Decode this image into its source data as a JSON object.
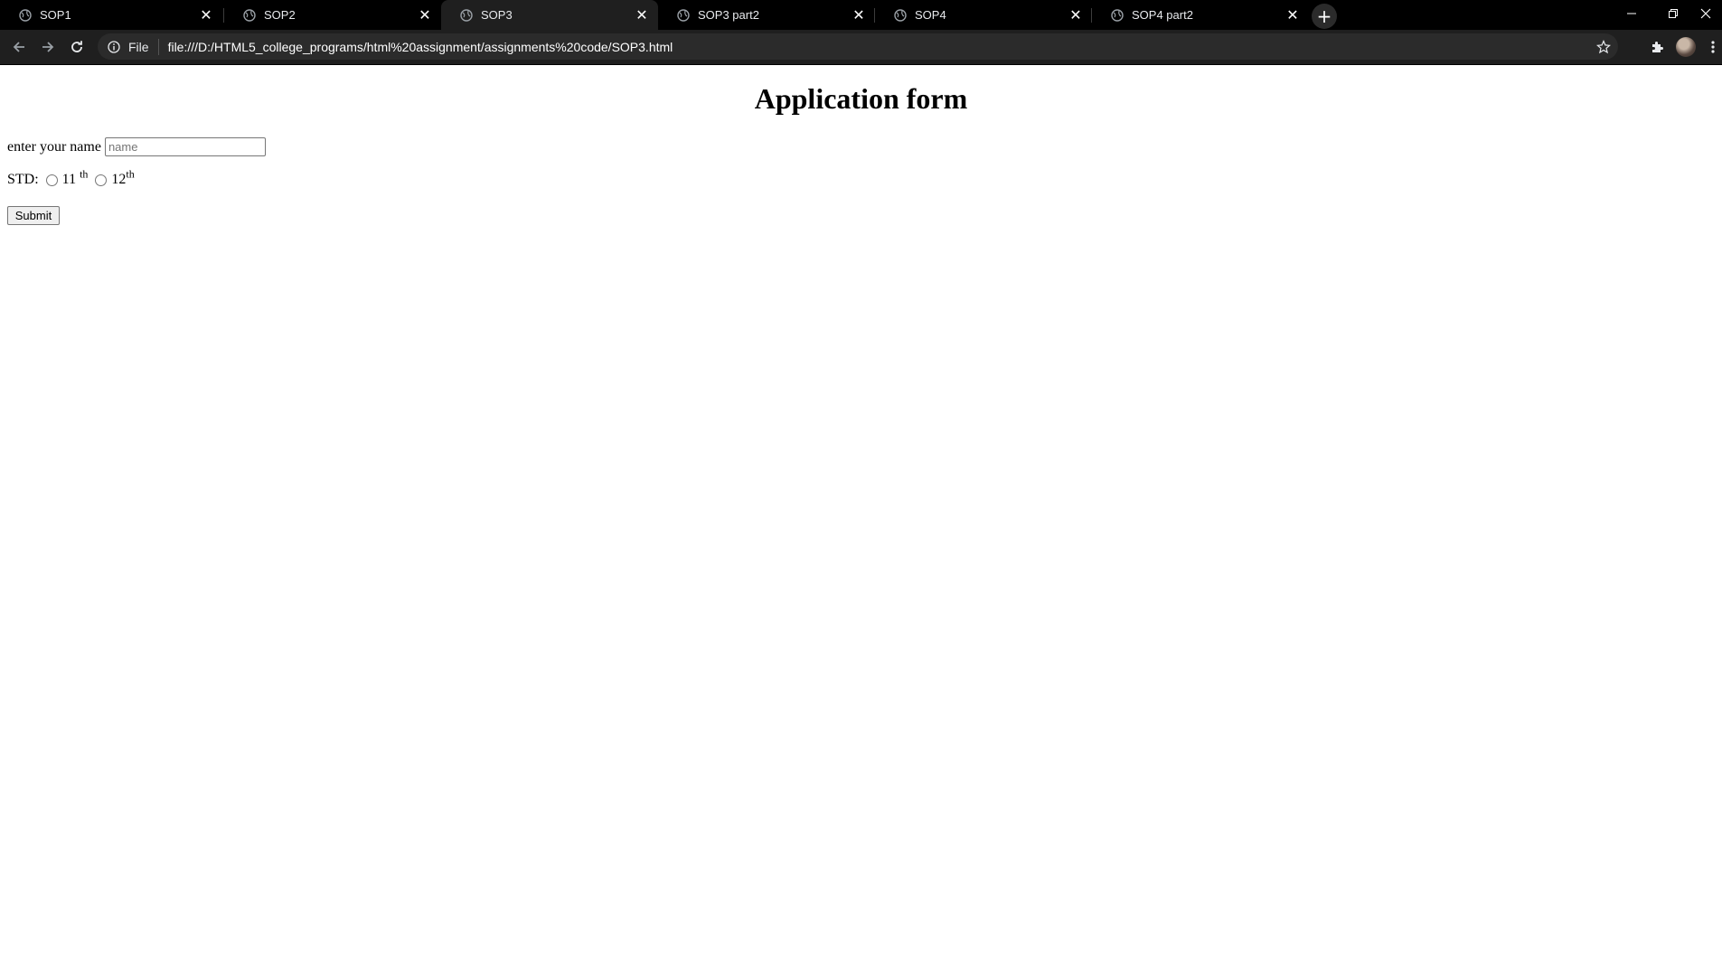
{
  "browser": {
    "tabs": [
      {
        "title": "SOP1",
        "active": false
      },
      {
        "title": "SOP2",
        "active": false
      },
      {
        "title": "SOP3",
        "active": true
      },
      {
        "title": "SOP3 part2",
        "active": false
      },
      {
        "title": "SOP4",
        "active": false
      },
      {
        "title": "SOP4 part2",
        "active": false
      }
    ],
    "tab_close_glyph": "✕",
    "new_tab_glyph": "+",
    "omnibox": {
      "scheme_label": "File",
      "url": "file:///D:/HTML5_college_programs/html%20assignment/assignments%20code/SOP3.html"
    },
    "colors": {
      "tabstrip_bg": "#000000",
      "active_tab_bg": "#1f1f1f",
      "omnibox_bg": "#2b2b2b",
      "loading_accent": "#4c6fa8"
    }
  },
  "page": {
    "heading": "Application form",
    "name_label": "enter your name",
    "name_placeholder": "name",
    "name_value": "",
    "std_label": "STD:",
    "options": [
      {
        "number": "11",
        "suffix": "th",
        "checked": false
      },
      {
        "number": "12",
        "suffix": "th",
        "checked": false
      }
    ],
    "submit_label": "Submit"
  }
}
